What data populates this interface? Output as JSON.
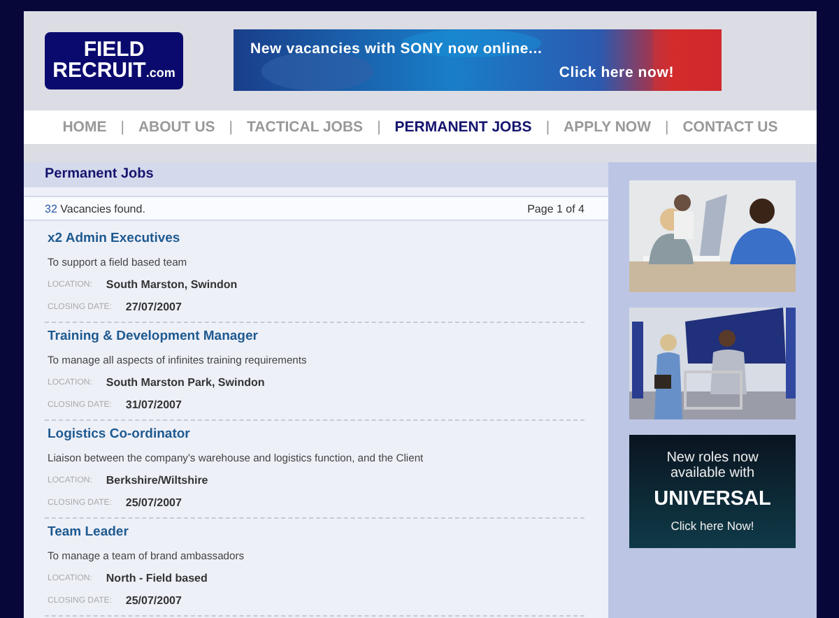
{
  "logo": {
    "line1": "FIELD",
    "line2": "RECRUIT",
    "suffix": ".com"
  },
  "banner": {
    "line1": "New vacancies with SONY now online...",
    "line2": "Click here now!"
  },
  "nav": [
    {
      "kind": "link",
      "label": "HOME",
      "selected": false
    },
    {
      "kind": "separator",
      "label": "|"
    },
    {
      "kind": "link",
      "label": "ABOUT US",
      "selected": false
    },
    {
      "kind": "separator",
      "label": "|"
    },
    {
      "kind": "link",
      "label": "TACTICAL JOBS",
      "selected": false
    },
    {
      "kind": "separator",
      "label": "|"
    },
    {
      "kind": "link",
      "label": "PERMANENT JOBS",
      "selected": true
    },
    {
      "kind": "separator",
      "label": "|"
    },
    {
      "kind": "link",
      "label": "APPLY NOW",
      "selected": false
    },
    {
      "kind": "separator",
      "label": "|"
    },
    {
      "kind": "link",
      "label": "CONTACT US",
      "selected": false
    }
  ],
  "panel": {
    "title": "Permanent Jobs",
    "count": "32",
    "count_text": "Vacancies found.",
    "page": "Page 1 of 4"
  },
  "jobs": [
    {
      "title": "x2 Admin Executives",
      "description": "To support a field based team",
      "location_label": "LOCATION:",
      "location": "South Marston, Swindon",
      "closing_label": "CLOSING DATE:",
      "closing_date": "27/07/2007"
    },
    {
      "title": "Training & Development Manager",
      "description": "To manage all aspects of infinites training requirements",
      "location_label": "LOCATION:",
      "location": "South Marston Park, Swindon",
      "closing_label": "CLOSING DATE:",
      "closing_date": "31/07/2007"
    },
    {
      "title": "Logistics Co-ordinator",
      "description": "Liaison between the company's warehouse and logistics function, and the Client",
      "location_label": "LOCATION:",
      "location": "Berkshire/Wiltshire",
      "closing_label": "CLOSING DATE:",
      "closing_date": "25/07/2007"
    },
    {
      "title": "Team Leader",
      "description": "To manage a team of brand ambassadors",
      "location_label": "LOCATION:",
      "location": "North - Field based",
      "closing_label": "CLOSING DATE:",
      "closing_date": "25/07/2007"
    }
  ],
  "ads": [
    {
      "kind": "picture"
    },
    {
      "kind": "picture"
    },
    {
      "kind": "promo",
      "line1": "New roles now",
      "line2": "available with",
      "brand": "UNIVERSAL",
      "cta": "Click here Now!"
    }
  ]
}
